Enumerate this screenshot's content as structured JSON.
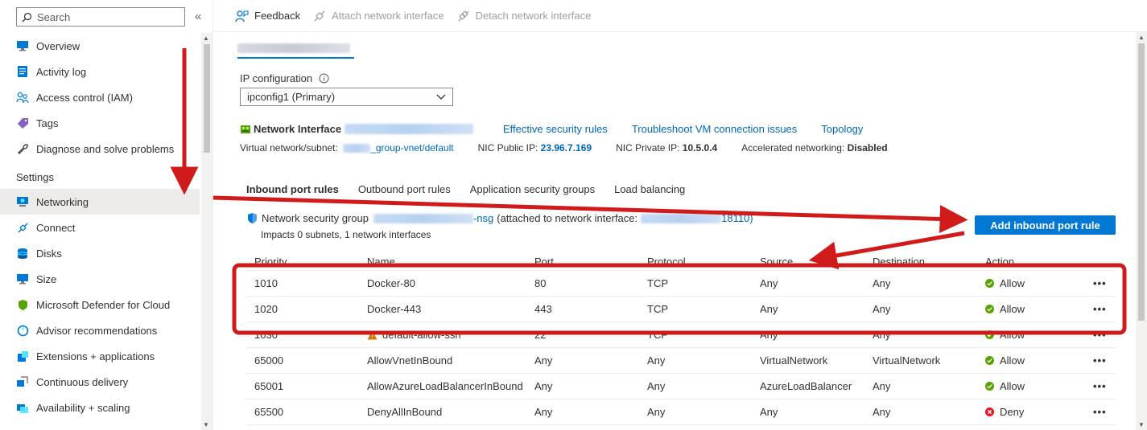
{
  "sidebar": {
    "search_placeholder": "Search",
    "collapse_glyph": "«",
    "items": [
      {
        "label": "Overview",
        "icon": "monitor-icon"
      },
      {
        "label": "Activity log",
        "icon": "activity-log-icon"
      },
      {
        "label": "Access control (IAM)",
        "icon": "people-icon"
      },
      {
        "label": "Tags",
        "icon": "tag-icon"
      },
      {
        "label": "Diagnose and solve problems",
        "icon": "wrench-icon"
      }
    ],
    "section_settings": "Settings",
    "settings_items": [
      {
        "label": "Networking",
        "icon": "network-icon"
      },
      {
        "label": "Connect",
        "icon": "connect-icon"
      },
      {
        "label": "Disks",
        "icon": "disks-icon"
      },
      {
        "label": "Size",
        "icon": "size-icon"
      },
      {
        "label": "Microsoft Defender for Cloud",
        "icon": "shield-icon"
      },
      {
        "label": "Advisor recommendations",
        "icon": "advisor-icon"
      },
      {
        "label": "Extensions + applications",
        "icon": "extensions-icon"
      },
      {
        "label": "Continuous delivery",
        "icon": "delivery-icon"
      },
      {
        "label": "Availability + scaling",
        "icon": "scaling-icon"
      }
    ]
  },
  "toolbar": {
    "feedback": "Feedback",
    "attach": "Attach network interface",
    "detach": "Detach network interface"
  },
  "ipconfig": {
    "label": "IP configuration",
    "value": "ipconfig1 (Primary)"
  },
  "nic": {
    "title": "Network Interface",
    "links": [
      "Effective security rules",
      "Troubleshoot VM connection issues",
      "Topology"
    ],
    "vnet_label": "Virtual network/subnet:",
    "vnet_value": "_group-vnet/default",
    "public_ip_label": "NIC Public IP:",
    "public_ip": "23.96.7.169",
    "private_ip_label": "NIC Private IP:",
    "private_ip": "10.5.0.4",
    "accel_label": "Accelerated networking:",
    "accel_value": "Disabled"
  },
  "subtabs": [
    "Inbound port rules",
    "Outbound port rules",
    "Application security groups",
    "Load balancing"
  ],
  "nsg": {
    "prefix": "Network security group",
    "name_suffix": "-nsg",
    "attached_text": "(attached to network interface:",
    "attached_suffix": "18110)",
    "impacts": "Impacts 0 subnets, 1 network interfaces",
    "add_button": "Add inbound port rule"
  },
  "table": {
    "headers": [
      "Priority",
      "Name",
      "Port",
      "Protocol",
      "Source",
      "Destination",
      "Action"
    ],
    "rows": [
      {
        "priority": "1010",
        "name": "Docker-80",
        "port": "80",
        "protocol": "TCP",
        "source": "Any",
        "destination": "Any",
        "action": "Allow",
        "warn": false
      },
      {
        "priority": "1020",
        "name": "Docker-443",
        "port": "443",
        "protocol": "TCP",
        "source": "Any",
        "destination": "Any",
        "action": "Allow",
        "warn": false
      },
      {
        "priority": "1030",
        "name": "default-allow-ssh",
        "port": "22",
        "protocol": "TCP",
        "source": "Any",
        "destination": "Any",
        "action": "Allow",
        "warn": true
      },
      {
        "priority": "65000",
        "name": "AllowVnetInBound",
        "port": "Any",
        "protocol": "Any",
        "source": "VirtualNetwork",
        "destination": "VirtualNetwork",
        "action": "Allow",
        "warn": false
      },
      {
        "priority": "65001",
        "name": "AllowAzureLoadBalancerInBound",
        "port": "Any",
        "protocol": "Any",
        "source": "AzureLoadBalancer",
        "destination": "Any",
        "action": "Allow",
        "warn": false
      },
      {
        "priority": "65500",
        "name": "DenyAllInBound",
        "port": "Any",
        "protocol": "Any",
        "source": "Any",
        "destination": "Any",
        "action": "Deny",
        "warn": false
      }
    ],
    "more_glyph": "•••"
  },
  "colors": {
    "accent": "#0078d4",
    "link": "#0067b8",
    "allow": "#57a300",
    "deny": "#e81123",
    "warn": "#db7500",
    "annotation_red": "#d11b1b"
  }
}
